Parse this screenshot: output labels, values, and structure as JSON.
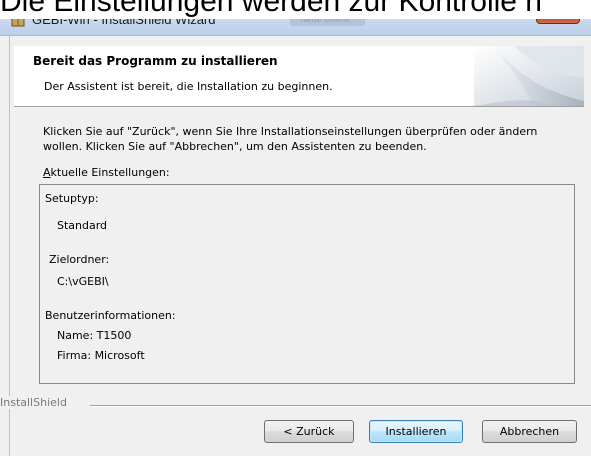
{
  "caption": "Die Einstellungen werden zur Kontrolle n",
  "window": {
    "title": "GEBI-Win - InstallShield Wizard",
    "blurred_title": "Neue Online",
    "close_glyph": "✕"
  },
  "header": {
    "title": "Bereit das Programm zu installieren",
    "subtitle": "Der Assistent ist bereit, die Installation zu beginnen."
  },
  "intro": {
    "line1": "Klicken Sie auf \"Zurück\", wenn Sie Ihre Installationseinstellungen überprüfen oder ändern",
    "line2": "wollen. Klicken Sie auf \"Abbrechen\", um den Assistenten zu beenden."
  },
  "settings": {
    "label_accel": "A",
    "label_rest": "ktuelle Einstellungen:",
    "setup_type_label": "Setuptyp:",
    "setup_type_value": "Standard",
    "folder_label": "Zielordner:",
    "folder_value": "C:\\vGEBI\\",
    "user_label": "Benutzerinformationen:",
    "user_name": "Name: T1500",
    "user_company": "Firma: Microsoft"
  },
  "footer": {
    "brand": "InstallShield",
    "back_label": "< Zurück",
    "install_label": "Installieren",
    "cancel_label": "Abbrechen"
  },
  "colors": {
    "titlebar": "#c9d9ee",
    "close": "#c4381c",
    "default_button_border": "#3c7fb1",
    "dialog_bg": "#f0f0f0"
  },
  "icons": {
    "title": "installer-box-icon",
    "close": "close-icon"
  }
}
